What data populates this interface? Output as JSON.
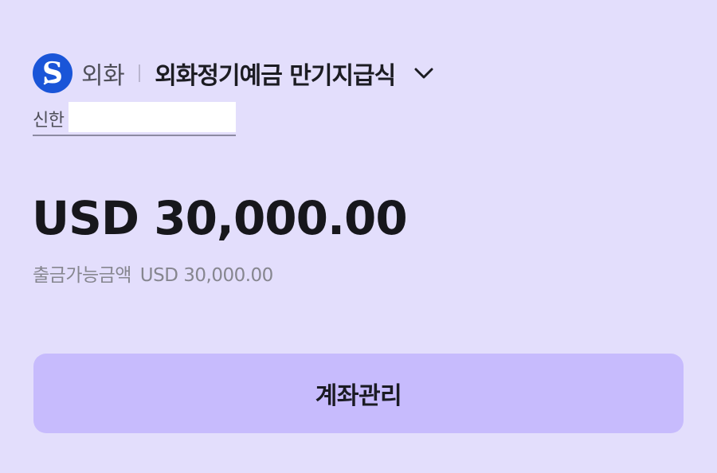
{
  "header": {
    "logo_icon": "shinhan-logo-icon",
    "category": "외화",
    "product_name": "외화정기예금 만기지급식",
    "dropdown_icon": "chevron-down-icon"
  },
  "account": {
    "bank_name": "신한"
  },
  "balance": {
    "currency": "USD",
    "amount": "30,000.00",
    "display": "USD 30,000.00"
  },
  "available": {
    "label": "출금가능금액",
    "amount": "USD 30,000.00"
  },
  "actions": {
    "manage_label": "계좌관리"
  },
  "colors": {
    "background": "#e3defc",
    "button": "#c7bbfd",
    "logo": "#1a55d8"
  }
}
